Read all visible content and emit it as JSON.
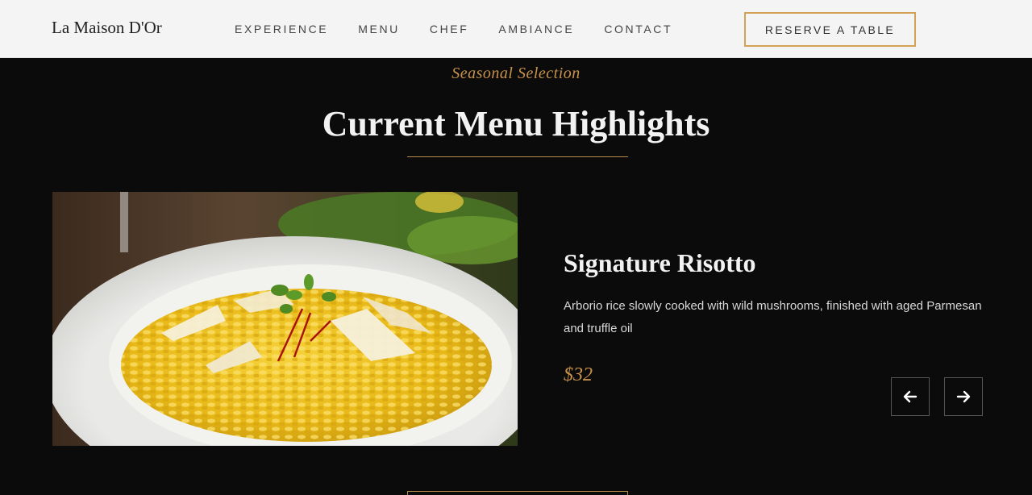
{
  "brand": {
    "name": "La Maison D'Or"
  },
  "nav": {
    "items": [
      {
        "label": "EXPERIENCE"
      },
      {
        "label": "MENU"
      },
      {
        "label": "CHEF"
      },
      {
        "label": "AMBIANCE"
      },
      {
        "label": "CONTACT"
      }
    ],
    "cta_label": "RESERVE A TABLE"
  },
  "section": {
    "eyebrow": "Seasonal Selection",
    "title": "Current Menu Highlights"
  },
  "dish": {
    "name": "Signature Risotto",
    "description": "Arborio rice slowly cooked with wild mushrooms, finished with aged Parmesan and truffle oil",
    "price": "$32",
    "image_icon": "risotto-photo"
  },
  "carousel": {
    "prev_icon": "arrow-left-icon",
    "next_icon": "arrow-right-icon"
  },
  "colors": {
    "accent": "#c8924a",
    "background": "#0b0b0b",
    "header_bg": "#f4f4f4"
  }
}
